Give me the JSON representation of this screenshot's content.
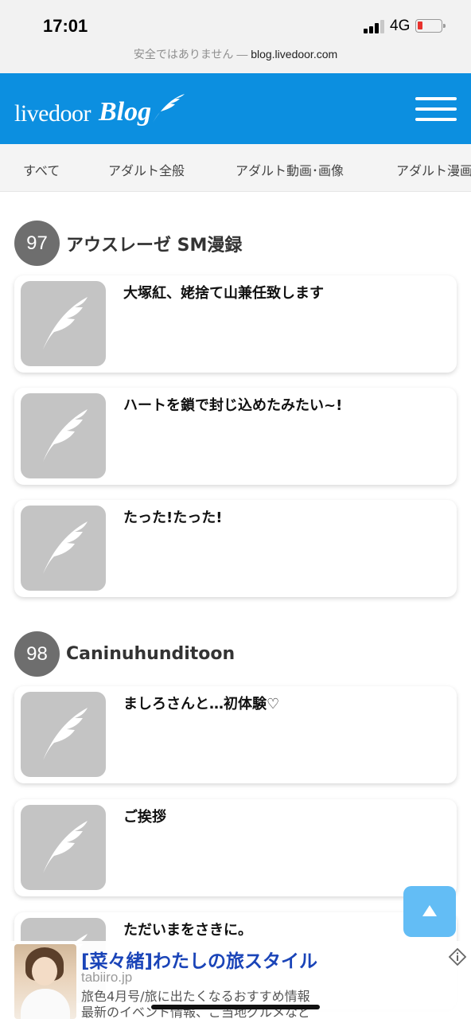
{
  "status_bar": {
    "time": "17:01",
    "network": "4G",
    "url_warning": "安全ではありません — ",
    "url_domain": "blog.livedoor.com",
    "battery_level": 0.15
  },
  "header": {
    "logo_text": "livedoor",
    "logo_blog": "Blog",
    "menu_icon": "hamburger-icon",
    "brand_color": "#0c8fe0"
  },
  "categories": [
    "すべて",
    "アダルト全般",
    "アダルト動画･画像",
    "アダルト漫画"
  ],
  "sections": [
    {
      "rank": "97",
      "name": "アウスレーゼ SM漫録",
      "entries": [
        "大塚紅、姥捨て山兼任致します",
        "ハートを鎖で封じ込めたみたい~!",
        "たった!たった!"
      ]
    },
    {
      "rank": "98",
      "name": "Caninuhunditoon",
      "entries": [
        "ましろさんと…初体験♡",
        "ご挨拶",
        "ただいまをさきに。"
      ]
    }
  ],
  "back_to_top": {
    "icon": "arrow-up-icon",
    "color": "#63bdf5"
  },
  "ad": {
    "title": "[菜々緒]わたしの旅スタイル",
    "domain": "tabiiro.jp",
    "line1": "旅色4月号/旅に出たくなるおすすめ情報",
    "line2": "最新のイベント情報、ご当地グルメなど",
    "info_icon": "ad-info-icon"
  }
}
